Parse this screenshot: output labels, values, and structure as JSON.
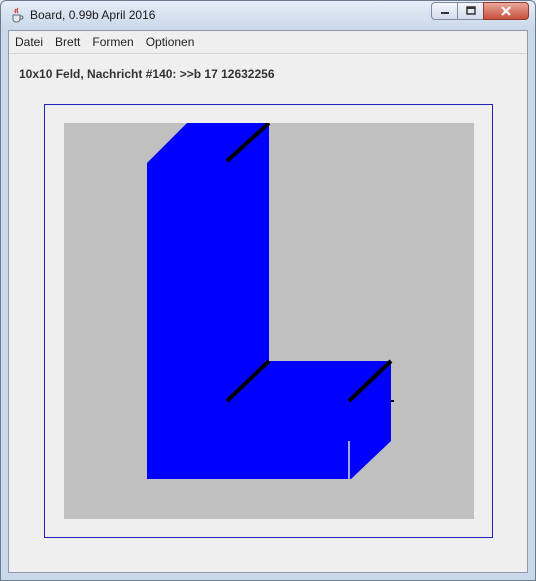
{
  "window": {
    "title": "Board, 0.99b April 2016",
    "icon": "java-cup-icon",
    "controls": [
      "minimize-icon",
      "maximize-icon",
      "close-icon"
    ]
  },
  "menubar": {
    "items": [
      {
        "label": "Datei"
      },
      {
        "label": "Brett"
      },
      {
        "label": "Formen"
      },
      {
        "label": "Optionen"
      }
    ]
  },
  "status": {
    "text": "10x10 Feld, Nachricht #140: >>b 17 12632256"
  },
  "board": {
    "background_color": "#c0c0c0",
    "frame_color": "#2222bb",
    "shape_color": "#0000ff"
  }
}
